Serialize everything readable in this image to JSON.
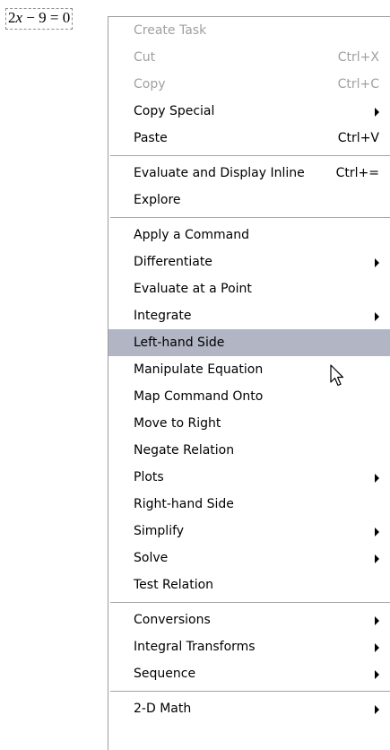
{
  "equation": {
    "coef": "2",
    "var": "x",
    "rest": "− 9 = 0"
  },
  "menu": {
    "groups": [
      [
        {
          "label": "Create Task",
          "shortcut": "",
          "submenu": false,
          "disabled": true
        },
        {
          "label": "Cut",
          "shortcut": "Ctrl+X",
          "submenu": false,
          "disabled": true
        },
        {
          "label": "Copy",
          "shortcut": "Ctrl+C",
          "submenu": false,
          "disabled": true
        },
        {
          "label": "Copy Special",
          "shortcut": "",
          "submenu": true,
          "disabled": false
        },
        {
          "label": "Paste",
          "shortcut": "Ctrl+V",
          "submenu": false,
          "disabled": false
        }
      ],
      [
        {
          "label": "Evaluate and Display Inline",
          "shortcut": "Ctrl+=",
          "submenu": false,
          "disabled": false
        },
        {
          "label": "Explore",
          "shortcut": "",
          "submenu": false,
          "disabled": false
        }
      ],
      [
        {
          "label": "Apply a Command",
          "shortcut": "",
          "submenu": false,
          "disabled": false
        },
        {
          "label": "Differentiate",
          "shortcut": "",
          "submenu": true,
          "disabled": false
        },
        {
          "label": "Evaluate at a Point",
          "shortcut": "",
          "submenu": false,
          "disabled": false
        },
        {
          "label": "Integrate",
          "shortcut": "",
          "submenu": true,
          "disabled": false
        },
        {
          "label": "Left-hand Side",
          "shortcut": "",
          "submenu": false,
          "disabled": false,
          "highlighted": true
        },
        {
          "label": "Manipulate Equation",
          "shortcut": "",
          "submenu": false,
          "disabled": false
        },
        {
          "label": "Map Command Onto",
          "shortcut": "",
          "submenu": false,
          "disabled": false
        },
        {
          "label": "Move to Right",
          "shortcut": "",
          "submenu": false,
          "disabled": false
        },
        {
          "label": "Negate Relation",
          "shortcut": "",
          "submenu": false,
          "disabled": false
        },
        {
          "label": "Plots",
          "shortcut": "",
          "submenu": true,
          "disabled": false
        },
        {
          "label": "Right-hand Side",
          "shortcut": "",
          "submenu": false,
          "disabled": false
        },
        {
          "label": "Simplify",
          "shortcut": "",
          "submenu": true,
          "disabled": false
        },
        {
          "label": "Solve",
          "shortcut": "",
          "submenu": true,
          "disabled": false
        },
        {
          "label": "Test Relation",
          "shortcut": "",
          "submenu": false,
          "disabled": false
        }
      ],
      [
        {
          "label": "Conversions",
          "shortcut": "",
          "submenu": true,
          "disabled": false
        },
        {
          "label": "Integral Transforms",
          "shortcut": "",
          "submenu": true,
          "disabled": false
        },
        {
          "label": "Sequence",
          "shortcut": "",
          "submenu": true,
          "disabled": false
        }
      ],
      [
        {
          "label": "2-D Math",
          "shortcut": "",
          "submenu": true,
          "disabled": false
        }
      ]
    ]
  },
  "colors": {
    "highlight": "#b1b5c4",
    "disabled_text": "#a0a0a0",
    "separator": "#a5a5a5"
  },
  "icons": {
    "submenu": "submenu-arrow-icon",
    "cursor": "mouse-pointer-icon"
  }
}
